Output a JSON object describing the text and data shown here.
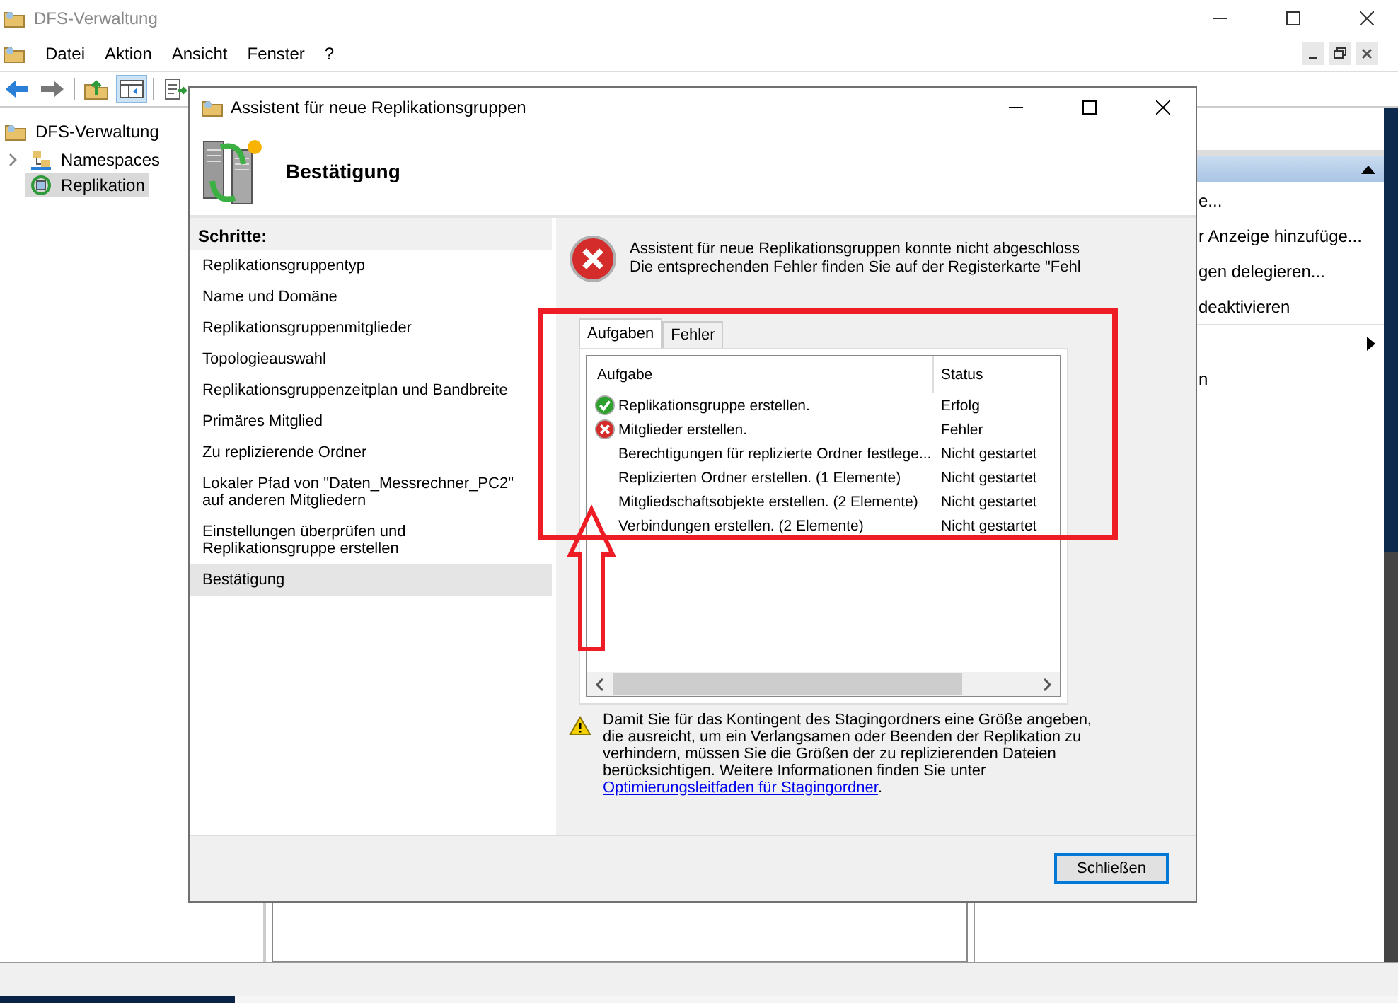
{
  "main_window": {
    "title": "DFS-Verwaltung",
    "menu": [
      "Datei",
      "Aktion",
      "Ansicht",
      "Fenster",
      "?"
    ]
  },
  "tree": [
    {
      "label": "DFS-Verwaltung",
      "selected": false,
      "children": [
        {
          "label": "Namespaces",
          "selected": false,
          "expanded": false
        },
        {
          "label": "Replikation",
          "selected": true
        }
      ]
    }
  ],
  "actions": [
    {
      "kind": "text",
      "label": "e..."
    },
    {
      "kind": "text",
      "label": "r Anzeige hinzufüge..."
    },
    {
      "kind": "text",
      "label": "gen delegieren..."
    },
    {
      "kind": "text",
      "label": "deaktivieren"
    },
    {
      "kind": "submenu"
    },
    {
      "kind": "text",
      "label": "n"
    }
  ],
  "dialog": {
    "title": "Assistent für neue Replikationsgruppen",
    "heading": "Bestätigung",
    "steps_header": "Schritte:",
    "steps": [
      {
        "label": "Replikationsgruppentyp",
        "selected": false
      },
      {
        "label": "Name und Domäne",
        "selected": false
      },
      {
        "label": "Replikationsgruppenmitglieder",
        "selected": false
      },
      {
        "label": "Topologieauswahl",
        "selected": false
      },
      {
        "label": "Replikationsgruppenzeitplan und Bandbreite",
        "selected": false
      },
      {
        "label": "Primäres Mitglied",
        "selected": false
      },
      {
        "label": "Zu replizierende Ordner",
        "selected": false
      },
      {
        "label": "Lokaler Pfad von \"Daten_Messrechner_PC2\" auf anderen Mitgliedern",
        "selected": false
      },
      {
        "label": "Einstellungen überprüfen und Replikationsgruppe erstellen",
        "selected": false
      },
      {
        "label": "Bestätigung",
        "selected": true
      }
    ],
    "message": [
      "Assistent für neue Replikationsgruppen konnte nicht abgeschloss",
      "Die entsprechenden Fehler finden Sie auf der Registerkarte \"Fehl"
    ],
    "tabs": [
      {
        "label": "Aufgaben",
        "selected": true
      },
      {
        "label": "Fehler",
        "selected": false
      }
    ],
    "columns": [
      "Aufgabe",
      "Status"
    ],
    "rows": [
      {
        "task": "Replikationsgruppe erstellen.",
        "status": "Erfolg",
        "kind": "success"
      },
      {
        "task": "Mitglieder erstellen.",
        "status": "Fehler",
        "kind": "error"
      },
      {
        "task": "Berechtigungen für replizierte Ordner festlege...",
        "status": "Nicht gestartet",
        "kind": "pending"
      },
      {
        "task": "Replizierten Ordner erstellen. (1 Elemente)",
        "status": "Nicht gestartet",
        "kind": "pending"
      },
      {
        "task": "Mitgliedschaftsobjekte erstellen. (2 Elemente)",
        "status": "Nicht gestartet",
        "kind": "pending"
      },
      {
        "task": "Verbindungen erstellen. (2 Elemente)",
        "status": "Nicht gestartet",
        "kind": "pending"
      }
    ],
    "warning": "Damit Sie für das Kontingent des Stagingordners eine Größe angeben, die ausreicht, um ein Verlangsamen oder Beenden der Replikation zu verhindern, müssen Sie die Größen der zu replizierenden Dateien berücksichtigen. Weitere Informationen finden Sie unter",
    "link": "Optimierungsleitfaden für Stagingordner",
    "link_after": ".",
    "button": "Schließen"
  }
}
